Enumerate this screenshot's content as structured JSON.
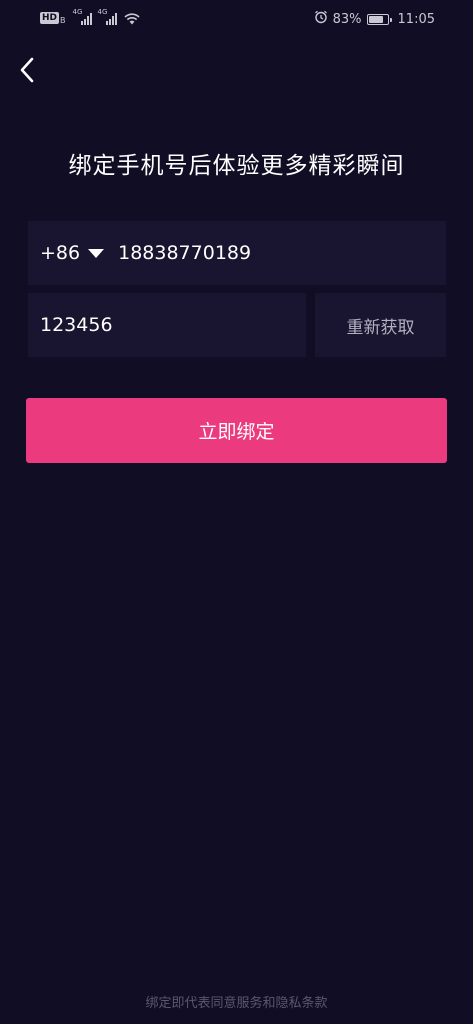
{
  "status_bar": {
    "hd_label": "HD",
    "hd_sub": "B",
    "sim1_network": "4G",
    "sim2_network": "4G",
    "battery_percent": "83%",
    "battery_level": 0.83,
    "time": "11:05"
  },
  "header": {
    "back_icon": "chevron-left-icon"
  },
  "title": "绑定手机号后体验更多精彩瞬间",
  "phone": {
    "country_code": "+86",
    "number": "18838770189"
  },
  "verification": {
    "code": "123456",
    "resend_label": "重新获取"
  },
  "bind_button_label": "立即绑定",
  "terms_text": "绑定即代表同意服务和隐私条款",
  "colors": {
    "background": "#110d24",
    "field_background": "#19142f",
    "accent": "#ec3a7f",
    "muted_text": "#5b576d"
  }
}
